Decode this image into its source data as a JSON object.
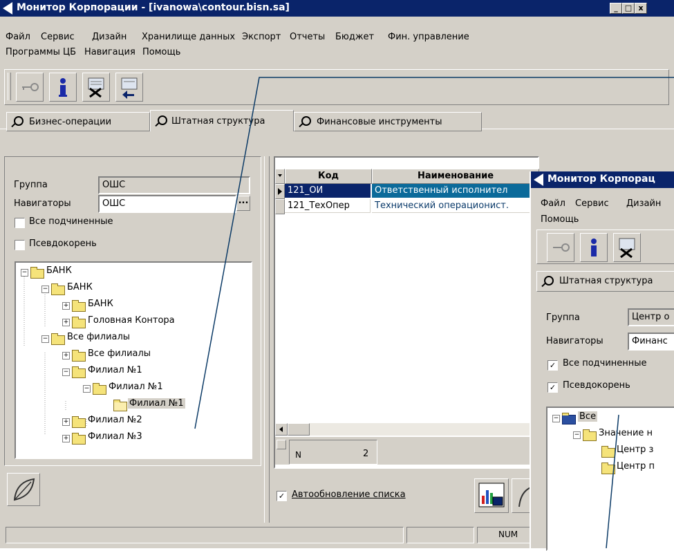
{
  "main_window": {
    "title": "Монитор Корпорации - [ivanowa\\contour.bisn.sa]",
    "caption_buttons": [
      "_",
      "□",
      "x"
    ],
    "menu_row1": [
      "Файл",
      "Сервис",
      "Дизайн",
      "Хранилище данных",
      "Экспорт",
      "Отчеты",
      "Бюджет",
      "Фин. управление"
    ],
    "menu_row2": [
      "Программы ЦБ",
      "Навигация",
      "Помощь"
    ],
    "toolbar_icons": [
      "key-icon",
      "info-icon",
      "delete-icon",
      "back-icon"
    ],
    "tabs": [
      "Бизнес-операции",
      "Штатная структура",
      "Финансовые инструменты"
    ],
    "left": {
      "group_label": "Группа",
      "group_value": "ОШС",
      "navigators_label": "Навигаторы",
      "navigators_value": "ОШС",
      "browse": "...",
      "all_subordinates": "Все подчиненные",
      "pseudoroot": "Псевдокорень",
      "tree": [
        "БАНК",
        "БАНК",
        "БАНК",
        "Головная Контора",
        "Все филиалы",
        "Все филиалы",
        "Филиал №1",
        "Филиал №1",
        "Филиал №1",
        "Филиал №2",
        "Филиал №3"
      ]
    },
    "grid": {
      "headers": [
        "Код",
        "Наименование"
      ],
      "rows": [
        {
          "code": "121_ОИ",
          "name": "Ответственный исполнител"
        },
        {
          "code": "121_ТехОпер",
          "name": "Технический операционист."
        }
      ],
      "footer_label": "N",
      "footer_count": "2"
    },
    "auto_refresh": "Автообновление списка",
    "status": "NUM"
  },
  "second_window": {
    "title": "Монитор Корпорац",
    "menu_row1": [
      "Файл",
      "Сервис",
      "Дизайн"
    ],
    "menu_row2": [
      "Помощь"
    ],
    "tab": "Штатная структура",
    "group_label": "Группа",
    "group_value": "Центр о",
    "navigators_label": "Навигаторы",
    "navigators_value": "Финанс",
    "all_subordinates": "Все подчиненные",
    "pseudoroot": "Псевдокорень",
    "tree": [
      "Все",
      "Значение н",
      "Центр з",
      "Центр п"
    ]
  },
  "colors": {
    "title_bg": "#0a246a",
    "selected_row": "#0a246a",
    "link_line": "#0b3a66"
  }
}
